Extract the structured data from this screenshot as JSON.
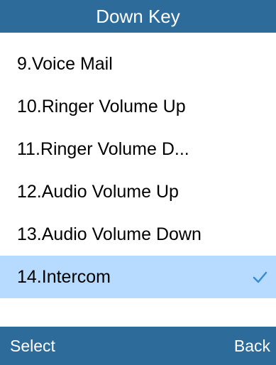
{
  "header": {
    "title": "Down Key"
  },
  "menu": {
    "items": [
      {
        "label": "9.Voice Mail"
      },
      {
        "label": "10.Ringer Volume Up"
      },
      {
        "label": "11.Ringer Volume D..."
      },
      {
        "label": "12.Audio Volume Up"
      },
      {
        "label": "13.Audio Volume Down"
      },
      {
        "label": "14.Intercom",
        "selected": true,
        "icon": "check-icon"
      }
    ]
  },
  "softkeys": {
    "left": "Select",
    "right": "Back"
  },
  "colors": {
    "bar": "#2d6b9a",
    "selection": "#b6dbff",
    "check": "#3a8ad6"
  }
}
